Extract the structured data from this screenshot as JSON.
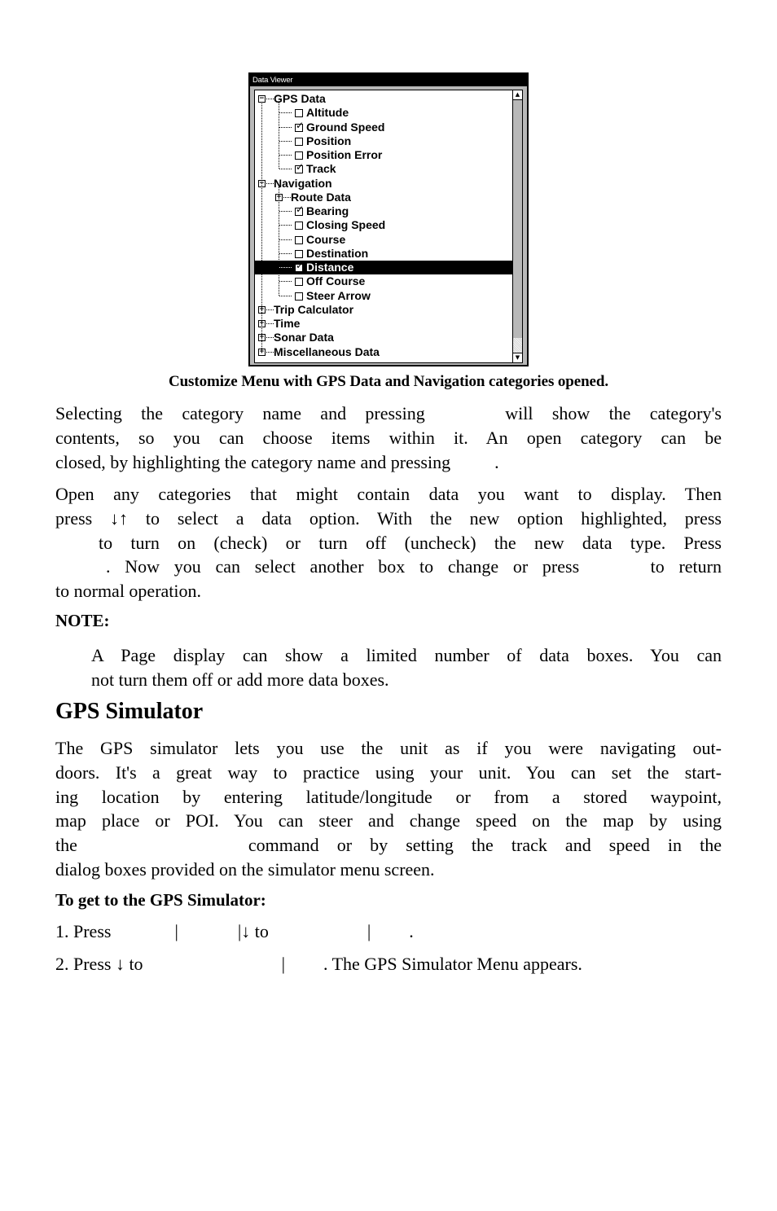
{
  "screenshot": {
    "window_title": "Data Viewer",
    "tree": [
      {
        "label": "GPS Data",
        "level": 0,
        "type": "category",
        "expanded": true
      },
      {
        "label": "Altitude",
        "level": 1,
        "type": "item",
        "checked": false
      },
      {
        "label": "Ground Speed",
        "level": 1,
        "type": "item",
        "checked": true
      },
      {
        "label": "Position",
        "level": 1,
        "type": "item",
        "checked": false
      },
      {
        "label": "Position Error",
        "level": 1,
        "type": "item",
        "checked": false
      },
      {
        "label": "Track",
        "level": 1,
        "type": "item",
        "checked": true
      },
      {
        "label": "Navigation",
        "level": 0,
        "type": "category",
        "expanded": true
      },
      {
        "label": "Route Data",
        "level": 1,
        "type": "category",
        "expanded": false
      },
      {
        "label": "Bearing",
        "level": 1,
        "type": "item",
        "checked": true
      },
      {
        "label": "Closing Speed",
        "level": 1,
        "type": "item",
        "checked": false
      },
      {
        "label": "Course",
        "level": 1,
        "type": "item",
        "checked": false
      },
      {
        "label": "Destination",
        "level": 1,
        "type": "item",
        "checked": false
      },
      {
        "label": "Distance",
        "level": 1,
        "type": "item",
        "checked": true,
        "selected": true
      },
      {
        "label": "Off Course",
        "level": 1,
        "type": "item",
        "checked": false
      },
      {
        "label": "Steer Arrow",
        "level": 1,
        "type": "item",
        "checked": false
      },
      {
        "label": "Trip Calculator",
        "level": 0,
        "type": "category",
        "expanded": false
      },
      {
        "label": "Time",
        "level": 0,
        "type": "category",
        "expanded": false
      },
      {
        "label": "Sonar Data",
        "level": 0,
        "type": "category",
        "expanded": false
      },
      {
        "label": "Miscellaneous Data",
        "level": 0,
        "type": "category",
        "expanded": false
      }
    ],
    "scroll_up_glyph": "▲",
    "scroll_down_glyph": "▼",
    "check_glyph": "✓",
    "expand_glyph": "+",
    "collapse_glyph": "−"
  },
  "caption": "Customize Menu with GPS Data and Navigation categories opened.",
  "para1": [
    [
      "Selecting the category name and pressing",
      "will show the category's"
    ],
    [
      "contents, so you can choose items within it. An open category can be"
    ],
    [
      "closed, by highlighting the category name and pressing",
      "."
    ]
  ],
  "para2": [
    [
      "Open any categories that might contain data you want to display. Then"
    ],
    [
      "press ↓↑ to select a data option. With the new option highlighted, press"
    ],
    [
      "to turn on (check) or turn off (uncheck) the new data type. Press"
    ],
    [
      ". Now you can select another box to change or press",
      "to return"
    ],
    [
      "to normal operation."
    ]
  ],
  "note": {
    "label": "NOTE:",
    "lines": [
      "A Page display can show a limited number of data boxes. You can",
      "not turn them off or add more data boxes."
    ]
  },
  "section_heading": "GPS Simulator",
  "para3": [
    [
      "The GPS simulator lets you use the unit as if you were navigating out-"
    ],
    [
      "doors. It's a great way to practice using your unit. You can set the start-"
    ],
    [
      "ing location by entering latitude/longitude or from a stored waypoint,"
    ],
    [
      "map place or POI. You can steer and change speed on the map by using"
    ],
    [
      "the",
      "command or by setting the track and speed in the"
    ],
    [
      "dialog boxes provided on the simulator menu screen."
    ]
  ],
  "procedure": {
    "heading": "To get to the GPS Simulator:",
    "steps": [
      {
        "a": "1. Press",
        "b": "|",
        "c": "|↓ to",
        "d": "|",
        "e": "."
      },
      {
        "a": "2. Press ↓ to",
        "b": "|",
        "c": ". The GPS Simulator Menu appears."
      }
    ]
  }
}
